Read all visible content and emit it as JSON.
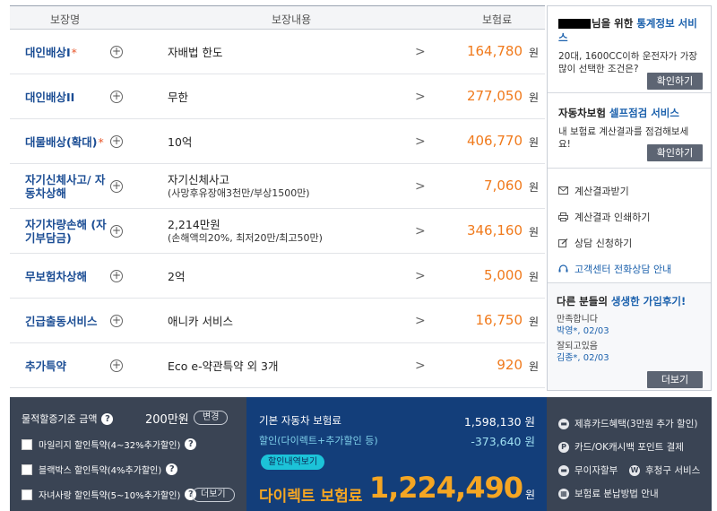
{
  "table": {
    "headers": {
      "name": "보장명",
      "content": "보장내용",
      "price": "보험료"
    },
    "won": "원",
    "rows": [
      {
        "name": "대인배상I",
        "star": "*",
        "content": "자배법 한도",
        "sub": "",
        "price": "164,780"
      },
      {
        "name": "대인배상II",
        "star": "",
        "content": "무한",
        "sub": "",
        "price": "277,050"
      },
      {
        "name": "대물배상(확대)",
        "star": "*",
        "content": "10억",
        "sub": "",
        "price": "406,770"
      },
      {
        "name": "자기신체사고/ 자동차상해",
        "star": "",
        "content": "자기신체사고",
        "sub": "(사망후유장애3천만/부상1500만)",
        "price": "7,060"
      },
      {
        "name": "자기차량손해 (자기부담금)",
        "star": "",
        "content": "2,214만원",
        "sub": "(손해액의20%, 최저20만/최고50만)",
        "price": "346,160"
      },
      {
        "name": "무보험차상해",
        "star": "",
        "content": "2억",
        "sub": "",
        "price": "5,000"
      },
      {
        "name": "긴급출동서비스",
        "star": "",
        "content": "애니카 서비스",
        "sub": "",
        "price": "16,750"
      },
      {
        "name": "추가특약",
        "star": "",
        "content": "Eco e-약관특약 외 3개",
        "sub": "",
        "price": "920"
      }
    ]
  },
  "sidebar": {
    "stats": {
      "title_suffix": "님을 위한 ",
      "title_blue": "통계정보 서비스",
      "desc": "20대, 1600CC이하 운전자가 가장 많이 선택한 조건은?",
      "button": "확인하기"
    },
    "selfcheck": {
      "title_prefix": "자동차보험 ",
      "title_blue": "셀프점검 서비스",
      "desc": "내 보험료 계산결과를 점검해보세요!",
      "button": "확인하기"
    },
    "links": [
      {
        "label": "계산결과받기",
        "icon": "mail-icon"
      },
      {
        "label": "계산결과 인쇄하기",
        "icon": "printer-icon"
      },
      {
        "label": "상담 신청하기",
        "icon": "edit-icon"
      },
      {
        "label": "고객센터 전화상담 안내",
        "icon": "headset-icon"
      }
    ],
    "reviews": {
      "title_prefix": "다른 분들의 ",
      "title_blue": "생생한 가입후기!",
      "items": [
        {
          "text": "만족합니다",
          "who": "박영*, 02/03"
        },
        {
          "text": "잘되고있음",
          "who": "김종*, 02/03"
        }
      ],
      "button": "더보기"
    }
  },
  "bottom": {
    "left": {
      "label": "물적할증기준 금액",
      "amount": "200만원",
      "change": "변경",
      "options": [
        "마일리지 할인특약(4~32%추가할인)",
        "블랙박스 할인특약(4%추가할인)",
        "자녀사랑 할인특약(5~10%추가할인)"
      ],
      "more": "더보기"
    },
    "middle": {
      "base_label": "기본 자동차 보험료",
      "base_value": "1,598,130 원",
      "discount_label": "할인(다이렉트+추가할인 등)",
      "discount_value": "-373,640 원",
      "pill": "할인내역보기",
      "direct_label": "다이렉트 보험료",
      "total": "1,224,490",
      "won": "원"
    },
    "right": {
      "items": [
        {
          "label": "제휴카드혜택(3만원 추가 할인)",
          "icon": "card-icon",
          "glyph": "▬"
        },
        {
          "label": "카드/OK캐시백 포인트 결제",
          "icon": "point-icon",
          "glyph": "P"
        },
        {
          "label": "무이자할부",
          "icon": "card-icon",
          "glyph": "▬"
        },
        {
          "label": "후청구 서비스",
          "icon": "won-icon",
          "glyph": "W"
        },
        {
          "label": "보험료 분납방법 안내",
          "icon": "calc-icon",
          "glyph": "▦"
        }
      ]
    }
  }
}
